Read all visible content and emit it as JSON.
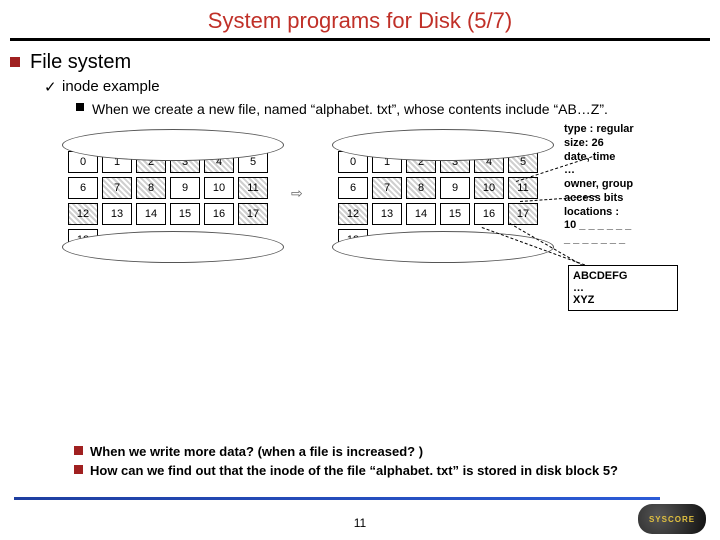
{
  "title": "System programs for Disk (5/7)",
  "pagenum": "11",
  "b1": "File system",
  "b2": "inode example",
  "b3": "When we create a new file, named “alphabet. txt”, whose contents include “AB…Z”.",
  "inode": {
    "l1": "type : regular",
    "l2": "size: 26",
    "l3": "date, time",
    "l4": "…",
    "l5": "owner, group",
    "l6": "access bits",
    "l7": "locations :",
    "l8": "10 _ _ _ _ _ _",
    "l9": "_ _ _ _ _ _ _"
  },
  "filebox": {
    "l1": "ABCDEFG",
    "l2": "…",
    "l3": "XYZ"
  },
  "q1": "When we write more data? (when a file is increased? )",
  "q2": "How can we find out that the inode of the file “alphabet. txt” is stored in disk block 5?",
  "cells": [
    "0",
    "1",
    "2",
    "3",
    "4",
    "5",
    "6",
    "7",
    "8",
    "9",
    "10",
    "11",
    "12",
    "13",
    "14",
    "15",
    "16",
    "17",
    "18",
    ".."
  ],
  "arrow": "⇨",
  "logo": "SYSCORE",
  "disk1_hatch": [
    2,
    3,
    4,
    7,
    8,
    11,
    12,
    17
  ],
  "disk2_hatch": [
    2,
    3,
    4,
    5,
    7,
    8,
    10,
    11,
    12,
    17
  ]
}
